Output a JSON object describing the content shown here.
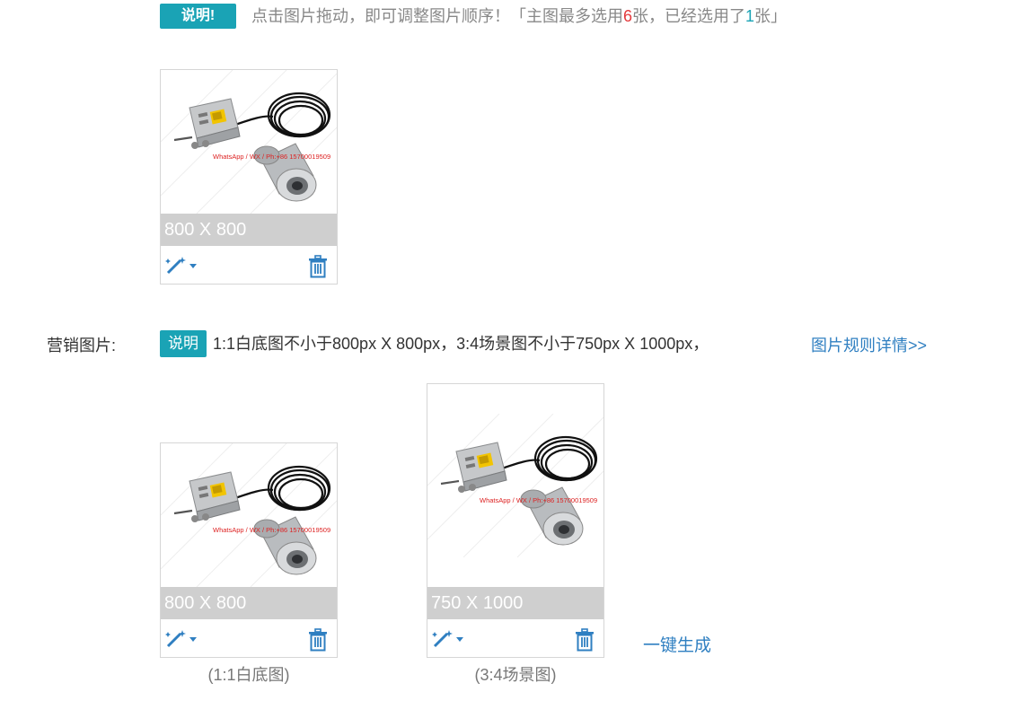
{
  "main_images": {
    "badge": "说明!",
    "hint_prefix": "点击图片拖动，即可调整图片顺序！「主图最多选用",
    "max_count": "6",
    "hint_middle": "张，已经选用了",
    "used_count": "1",
    "hint_suffix": "张」",
    "items": [
      {
        "dimensions": "800 X 800",
        "watermark": "WhatsApp / WX / Ph:+86 15700019509"
      }
    ]
  },
  "marketing": {
    "label": "营销图片:",
    "badge": "说明",
    "description": "1:1白底图不小于800px X 800px，3:4场景图不小于750px X 1000px，",
    "rules_link": "图片规则详情>>",
    "items": [
      {
        "dimensions": "800 X 800",
        "caption": "(1:1白底图)",
        "watermark": "WhatsApp / WX / Ph:+86 15700019509"
      },
      {
        "dimensions": "750 X 1000",
        "caption": "(3:4场景图)",
        "watermark": "WhatsApp / WX / Ph:+86 15700019509"
      }
    ],
    "generate_link": "一键生成"
  },
  "colors": {
    "accent": "#1aa3b5",
    "link": "#2f7fc1",
    "highlight": "#e4393c"
  },
  "icons": {
    "edit": "magic-wand-icon",
    "delete": "trash-icon"
  }
}
